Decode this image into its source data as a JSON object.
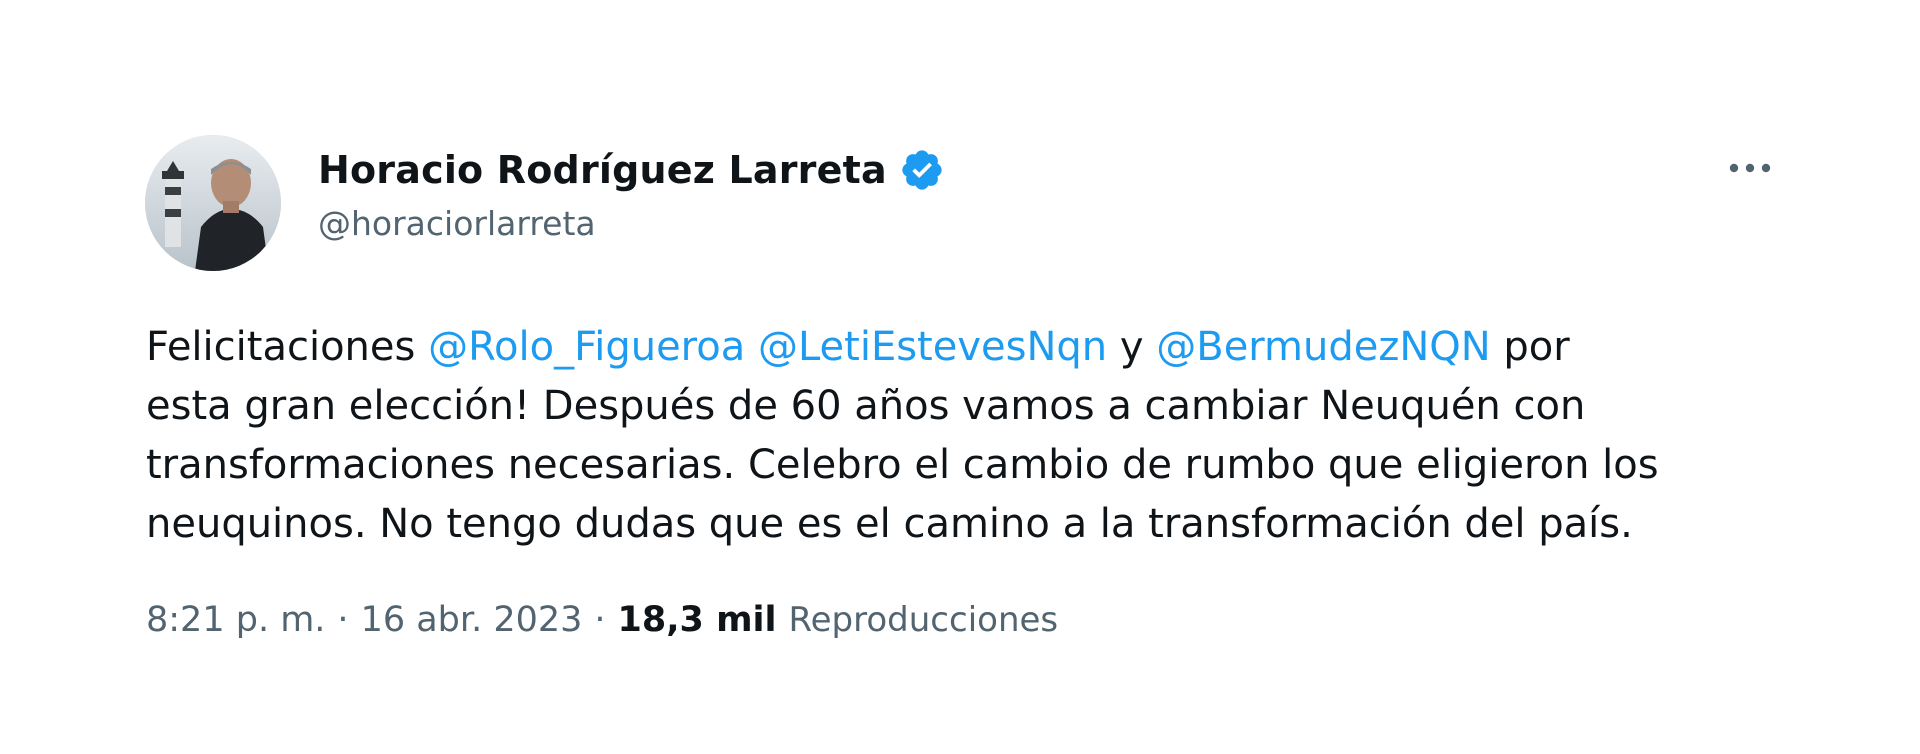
{
  "author": {
    "display_name": "Horacio Rodríguez Larreta",
    "handle": "@horaciorlarreta",
    "verified_color": "#1d9bf0"
  },
  "tweet": {
    "lines": [
      [
        {
          "type": "text",
          "text": "Felicitaciones "
        },
        {
          "type": "mention",
          "text": "@Rolo_Figueroa"
        },
        {
          "type": "text",
          "text": " "
        },
        {
          "type": "mention",
          "text": "@LetiEstevesNqn"
        },
        {
          "type": "text",
          "text": " y "
        },
        {
          "type": "mention",
          "text": "@BermudezNQN"
        },
        {
          "type": "text",
          "text": " por"
        }
      ],
      [
        {
          "type": "text",
          "text": "esta gran elección! Después de 60 años vamos a cambiar Neuquén con"
        }
      ],
      [
        {
          "type": "text",
          "text": "transformaciones necesarias. Celebro el cambio de rumbo que eligieron los"
        }
      ],
      [
        {
          "type": "text",
          "text": "neuquinos. No tengo dudas que es el camino a la transformación del país."
        }
      ]
    ]
  },
  "meta": {
    "time": "8:21 p. m.",
    "separator": "·",
    "date": "16 abr. 2023",
    "views_count": "18,3 mil",
    "views_label": "Reproducciones"
  },
  "colors": {
    "text": "#0f1419",
    "secondary": "#536471",
    "link": "#1d9bf0"
  },
  "icons": {
    "more": "more-horizontal-icon",
    "verified": "verified-badge-icon"
  }
}
